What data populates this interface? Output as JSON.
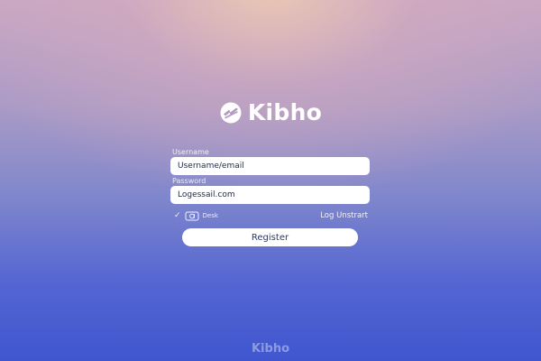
{
  "brand": {
    "name": "Kibho",
    "logo_icon": "kibho-logo-icon",
    "text_color": "#ffffff"
  },
  "form": {
    "username_label": "Username",
    "username_placeholder": "Username/email",
    "password_label": "Password",
    "password_value": "Logessail.com",
    "remember_icon": "desk-icon",
    "remember_label": "Desk",
    "check_glyph": "✓",
    "forgot_link": "Log Unstrart",
    "register_label": "Register"
  },
  "footer": {
    "brand": "Kibho"
  },
  "colors": {
    "background_top": "#c9a7c4",
    "background_bottom": "#3f56cf",
    "button_text": "#2b3a66",
    "input_text": "#1e2a4a"
  }
}
